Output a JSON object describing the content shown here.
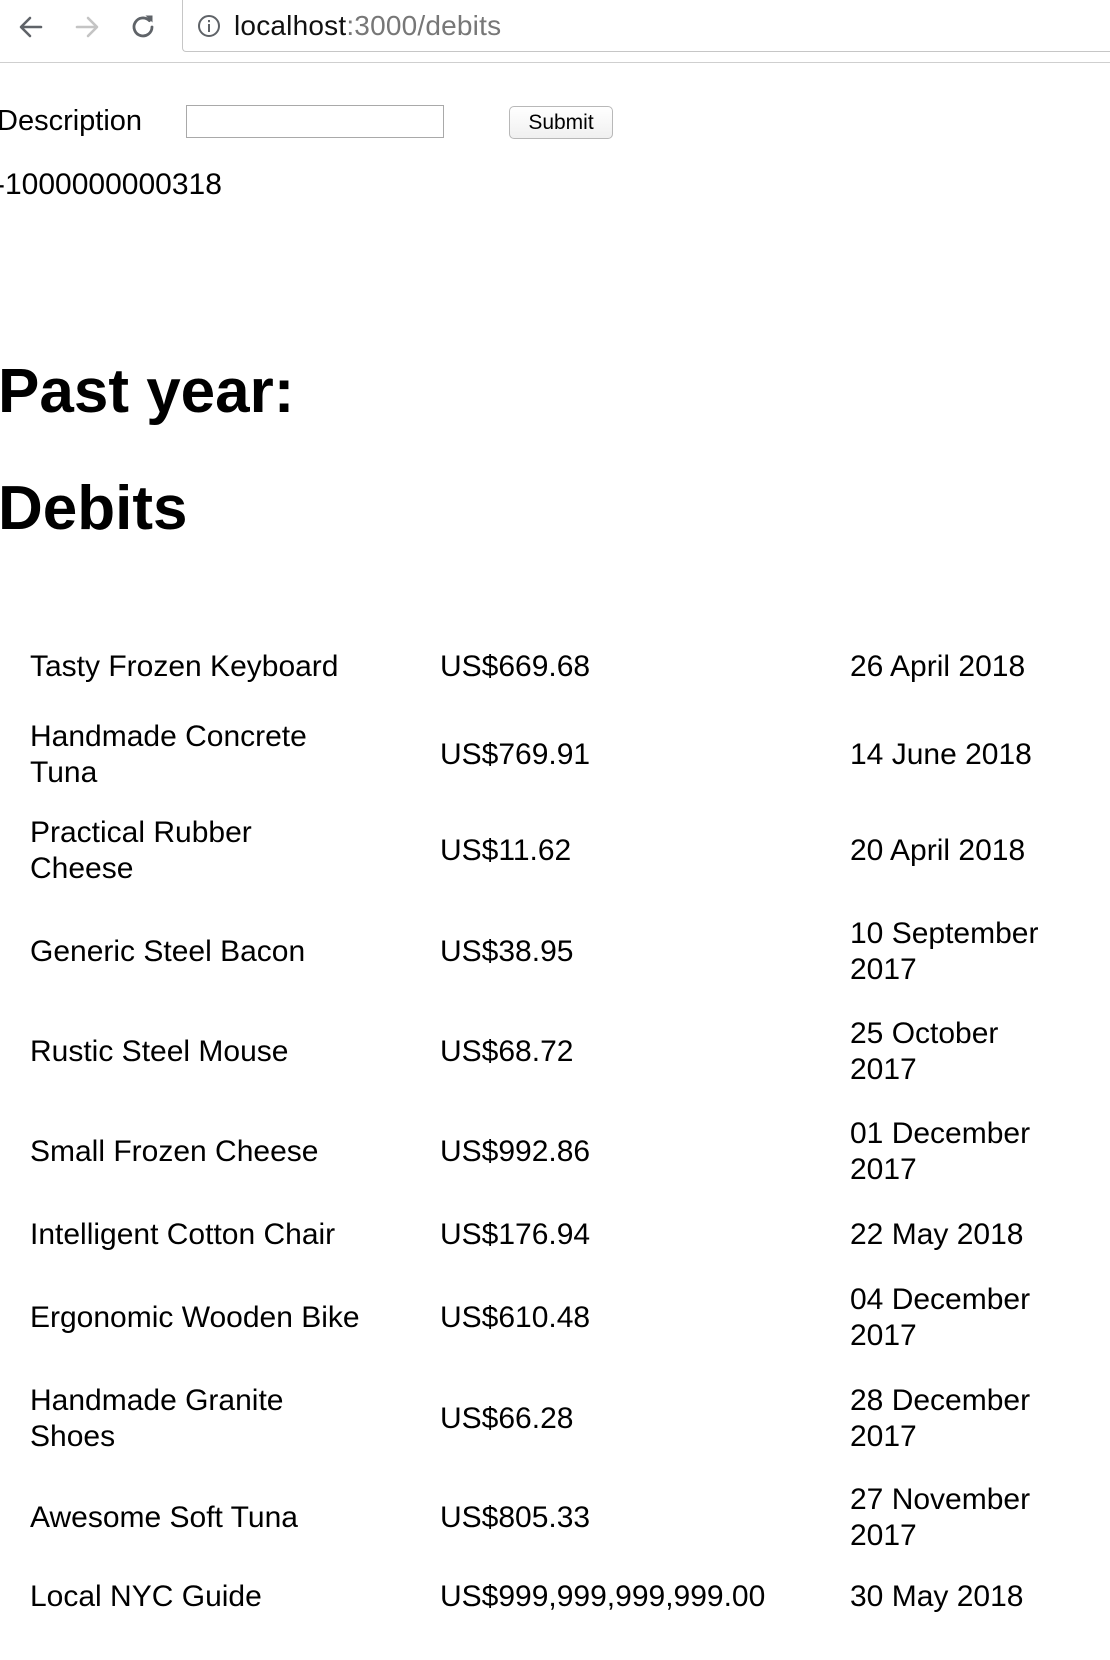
{
  "browser": {
    "url_host": "localhost",
    "url_path": ":3000/debits",
    "icons": {
      "back": "arrow-left-icon",
      "forward": "arrow-right-icon",
      "reload": "reload-icon",
      "info": "info-icon"
    }
  },
  "form": {
    "description_label": "Description",
    "description_value": "",
    "submit_label": "Submit"
  },
  "balance": "-1000000000318",
  "headings": {
    "past_year": "Past year:",
    "debits": "Debits"
  },
  "debits": [
    {
      "description": "Tasty Frozen Keyboard",
      "amount": "US$669.68",
      "date": "26 April 2018"
    },
    {
      "description": "Handmade Concrete Tuna",
      "amount": "US$769.91",
      "date": "14 June 2018"
    },
    {
      "description": "Practical Rubber Cheese",
      "amount": "US$11.62",
      "date": "20 April 2018"
    },
    {
      "description": "Generic Steel Bacon",
      "amount": "US$38.95",
      "date": "10 September 2017"
    },
    {
      "description": "Rustic Steel Mouse",
      "amount": "US$68.72",
      "date": "25 October 2017"
    },
    {
      "description": "Small Frozen Cheese",
      "amount": "US$992.86",
      "date": "01 December 2017"
    },
    {
      "description": "Intelligent Cotton Chair",
      "amount": "US$176.94",
      "date": "22 May 2018"
    },
    {
      "description": "Ergonomic Wooden Bike",
      "amount": "US$610.48",
      "date": "04 December 2017"
    },
    {
      "description": "Handmade Granite Shoes",
      "amount": "US$66.28",
      "date": "28 December 2017"
    },
    {
      "description": "Awesome Soft Tuna",
      "amount": "US$805.33",
      "date": "27 November 2017"
    },
    {
      "description": "Local NYC Guide",
      "amount": "US$999,999,999,999.00",
      "date": "30 May 2018"
    }
  ]
}
